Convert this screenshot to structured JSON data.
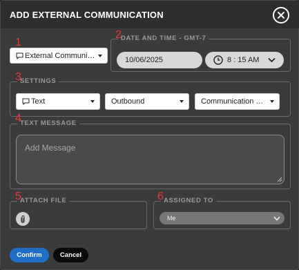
{
  "dialog": {
    "title": "ADD EXTERNAL COMMUNICATION"
  },
  "annotations": [
    "1",
    "2",
    "3",
    "4",
    "5",
    "6"
  ],
  "communication_select": {
    "value": "External Communicat..."
  },
  "datetime": {
    "legend": "DATE AND TIME - GMT-7",
    "date": "10/06/2025",
    "time": "8 : 15 AM"
  },
  "settings": {
    "legend": "SETTINGS",
    "mode": "Text",
    "direction": "Outbound",
    "type_placeholder": "Communication Type"
  },
  "text_message": {
    "legend": "TEXT MESSAGE",
    "placeholder": "Add Message"
  },
  "attach": {
    "legend": "ATTACH FILE"
  },
  "assigned": {
    "legend": "ASSIGNED TO",
    "value": "Me"
  },
  "footer": {
    "confirm": "Confirm",
    "cancel": "Cancel"
  },
  "colors": {
    "accent": "#1f6fc9",
    "annotation": "#e53935",
    "dialog_bg": "#3b3b3b"
  },
  "icons": {
    "close": "close-icon",
    "message": "message-icon",
    "clock": "clock-icon",
    "chevron": "chevron-down-icon",
    "attach": "paperclip-icon"
  }
}
